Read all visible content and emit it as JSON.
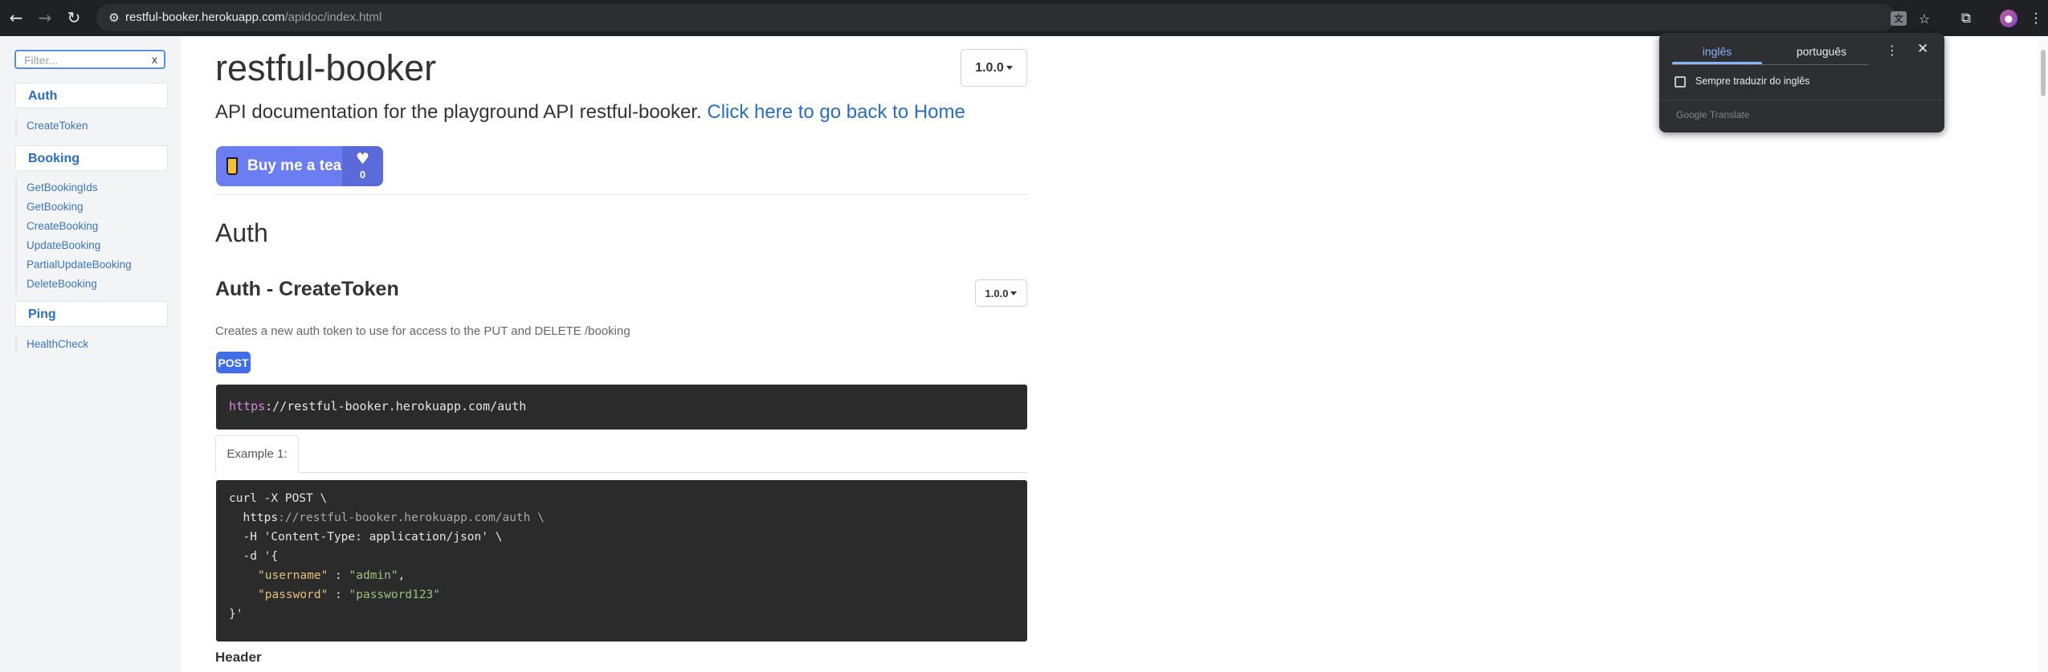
{
  "browser": {
    "back_icon": "←",
    "forward_icon": "→",
    "reload_icon": "↻",
    "site_info_icon": "⚙",
    "url_host": "restful-booker.herokuapp.com",
    "url_path": "/apidoc/index.html",
    "translate_icon": "文",
    "star_icon": "☆",
    "extensions_icon": "⧉",
    "avatar_icon": "●",
    "menu_icon": "⋮"
  },
  "sidebar": {
    "filter_placeholder": "Filter...",
    "filter_clear": "x",
    "groups": [
      {
        "label": "Auth",
        "items": [
          "CreateToken"
        ]
      },
      {
        "label": "Booking",
        "items": [
          "GetBookingIds",
          "GetBooking",
          "CreateBooking",
          "UpdateBooking",
          "PartialUpdateBooking",
          "DeleteBooking"
        ]
      },
      {
        "label": "Ping",
        "items": [
          "HealthCheck"
        ]
      }
    ]
  },
  "main": {
    "title": "restful-booker",
    "version": "1.0.0",
    "intro_text": "API documentation for the playground API restful-booker.",
    "intro_link": "Click here to go back to Home",
    "buy_tea": {
      "label": "Buy me a tea",
      "heart": "♥",
      "count": "0"
    },
    "section_heading": "Auth",
    "endpoint": {
      "title": "Auth - CreateToken",
      "version": "1.0.0",
      "description": "Creates a new auth token to use for access to the PUT and DELETE /booking",
      "method": "POST",
      "url_scheme": "https",
      "url_rest": "://restful-booker.herokuapp.com/auth",
      "example_tab": "Example 1:",
      "code": {
        "l1": "curl -X POST \\",
        "l2a": "  https",
        "l2b": "://restful-booker.herokuapp.com/auth \\",
        "l3": "  -H 'Content-Type: application/json' \\",
        "l4": "  -d '{",
        "l5_key": "\"username\"",
        "l5_sep": " : ",
        "l5_val": "\"admin\"",
        "l5_end": ",",
        "l6_key": "\"password\"",
        "l6_sep": " : ",
        "l6_val": "\"password123\"",
        "l7": "}'"
      },
      "header_heading": "Header"
    }
  },
  "translate_popup": {
    "tab_source": "inglês",
    "tab_target": "português",
    "more_icon": "⋮",
    "close_icon": "✕",
    "checkbox_label": "Sempre traduzir do inglês",
    "footer": "Google Translate"
  }
}
